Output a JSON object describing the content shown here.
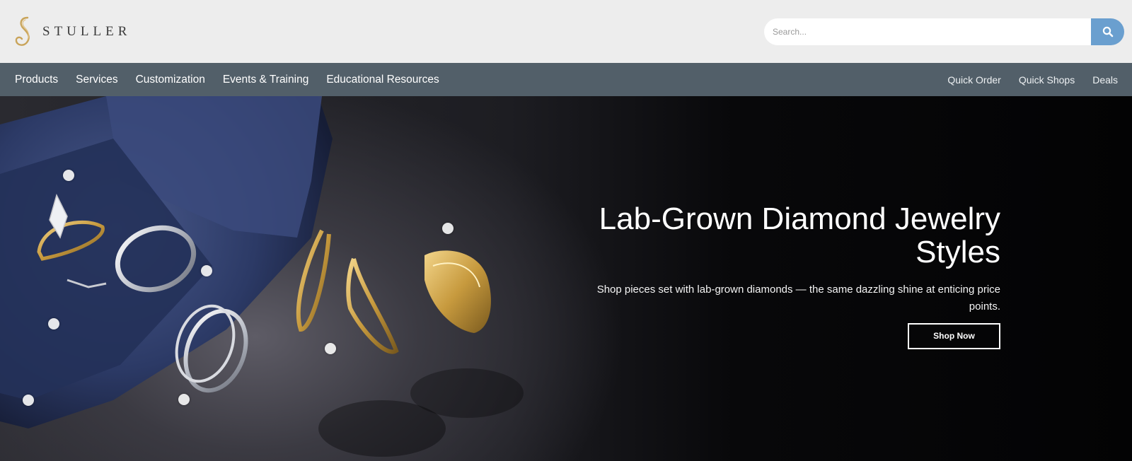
{
  "header": {
    "logo_text": "STULLER",
    "search": {
      "placeholder": "Search..."
    },
    "search_icon": "search-icon"
  },
  "nav": {
    "primary": [
      {
        "label": "Products"
      },
      {
        "label": "Services"
      },
      {
        "label": "Customization"
      },
      {
        "label": "Events & Training"
      },
      {
        "label": "Educational Resources"
      }
    ],
    "secondary": [
      {
        "label": "Quick Order"
      },
      {
        "label": "Quick Shops"
      },
      {
        "label": "Deals"
      }
    ]
  },
  "hero": {
    "title": "Lab-Grown Diamond Jewelry Styles",
    "subtitle": "Shop pieces set with lab-grown diamonds — the same dazzling shine at enticing price points.",
    "cta_label": "Shop Now"
  },
  "colors": {
    "header_bg": "#ededed",
    "nav_bg": "#525f69",
    "search_button": "#6a9fcf",
    "logo_gold": "#c9a45a",
    "hero_bg": "#0a0a0c"
  }
}
